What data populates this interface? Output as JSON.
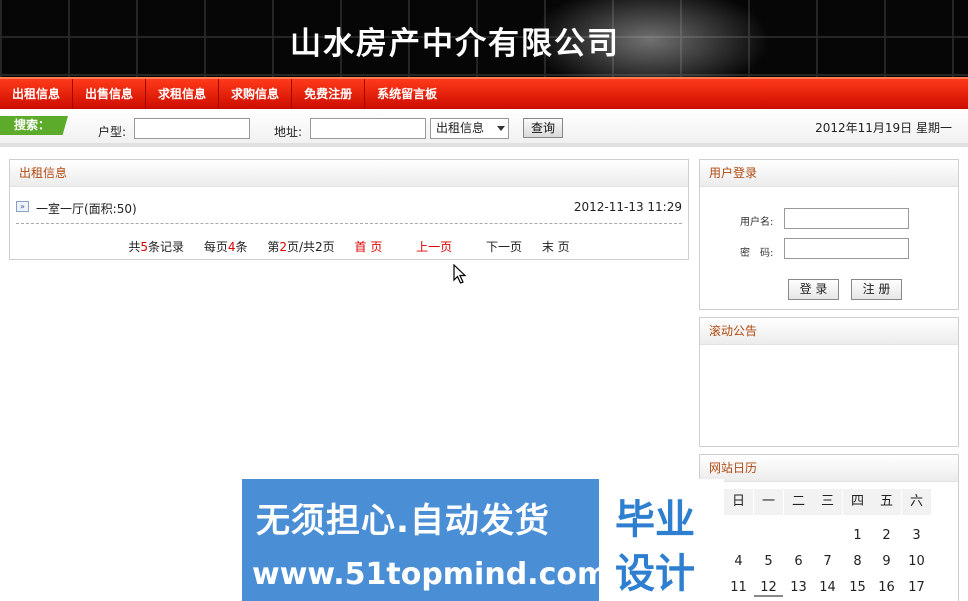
{
  "header": {
    "title": "山水房产中介有限公司"
  },
  "nav": {
    "items": [
      "出租信息",
      "出售信息",
      "求租信息",
      "求购信息",
      "免费注册",
      "系统留言板"
    ]
  },
  "search": {
    "tag": "搜索：",
    "type_label": "户型:",
    "address_label": "地址:",
    "category_selected": "出租信息",
    "submit_label": "查询",
    "date_text": "2012年11月19日 星期一"
  },
  "rental_panel": {
    "title": "出租信息",
    "listings": [
      {
        "title": "一室一厅(面积:50)",
        "date": "2012-11-13 11:29"
      }
    ],
    "pager": {
      "total_prefix": "共",
      "total": "5",
      "total_suffix": "条记录",
      "per_prefix": "每页",
      "per": "4",
      "per_suffix": "条",
      "page_prefix": "第",
      "page": "2",
      "page_suffix": "页/共2页",
      "first": "首 页",
      "prev": "上一页",
      "next": "下一页",
      "last": "末 页"
    }
  },
  "login_panel": {
    "title": "用户登录",
    "username_label": "用户名:",
    "password_label": "密　码:",
    "login_label": "登 录",
    "register_label": "注 册"
  },
  "notice_panel": {
    "title": "滚动公告"
  },
  "calendar_panel": {
    "title": "网站日历",
    "weekdays": [
      "日",
      "一",
      "二",
      "三",
      "四",
      "五",
      "六"
    ],
    "rows": [
      [
        "",
        "",
        "",
        "",
        "1",
        "2",
        "3"
      ],
      [
        "4",
        "5",
        "6",
        "7",
        "8",
        "9",
        "10"
      ],
      [
        "11",
        "12",
        "13",
        "14",
        "15",
        "16",
        "17"
      ]
    ],
    "today": "12"
  },
  "watermark": {
    "line1": "无须担心.自动发货",
    "line2": "www.51topmind.com",
    "box1": "毕业",
    "box2": "设计"
  }
}
